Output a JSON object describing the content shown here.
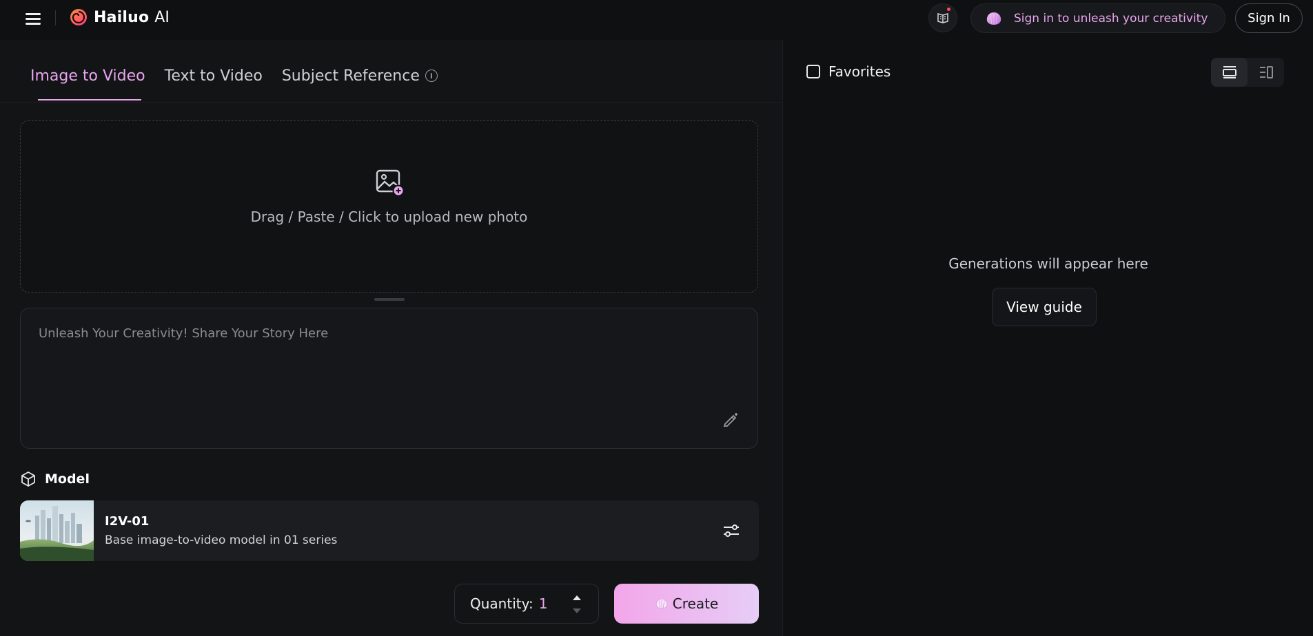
{
  "header": {
    "brand_bold": "Hailuo",
    "brand_light": "AI",
    "signin_prompt": "Sign in to unleash your creativity",
    "signin_label": "Sign In"
  },
  "tabs": [
    {
      "label": "Image to Video",
      "active": true
    },
    {
      "label": "Text to Video",
      "active": false
    },
    {
      "label": "Subject Reference",
      "active": false
    }
  ],
  "upload": {
    "text": "Drag / Paste / Click to upload new photo"
  },
  "prompt": {
    "placeholder": "Unleash Your Creativity! Share Your Story Here",
    "value": ""
  },
  "model": {
    "section_label": "Model",
    "name": "I2V-01",
    "description": "Base image-to-video model in 01 series"
  },
  "quantity": {
    "label": "Quantity:",
    "value": "1"
  },
  "create_label": "Create",
  "results": {
    "favorites_label": "Favorites",
    "empty_text": "Generations will appear here",
    "guide_label": "View guide"
  },
  "colors": {
    "accent": "#e8a6ec",
    "create_gradient_start": "#f3a6ea",
    "create_gradient_end": "#e6cdf6",
    "background": "#111214"
  },
  "icons": {
    "menu": "hamburger-menu-icon",
    "logo": "hailuo-spiral-logo-icon",
    "docs": "book-icon",
    "upload": "image-add-icon",
    "wand": "magic-wand-icon",
    "model": "cube-icon",
    "settings": "sliders-icon",
    "view_grid": "single-column-view-icon",
    "view_list": "list-view-icon"
  }
}
